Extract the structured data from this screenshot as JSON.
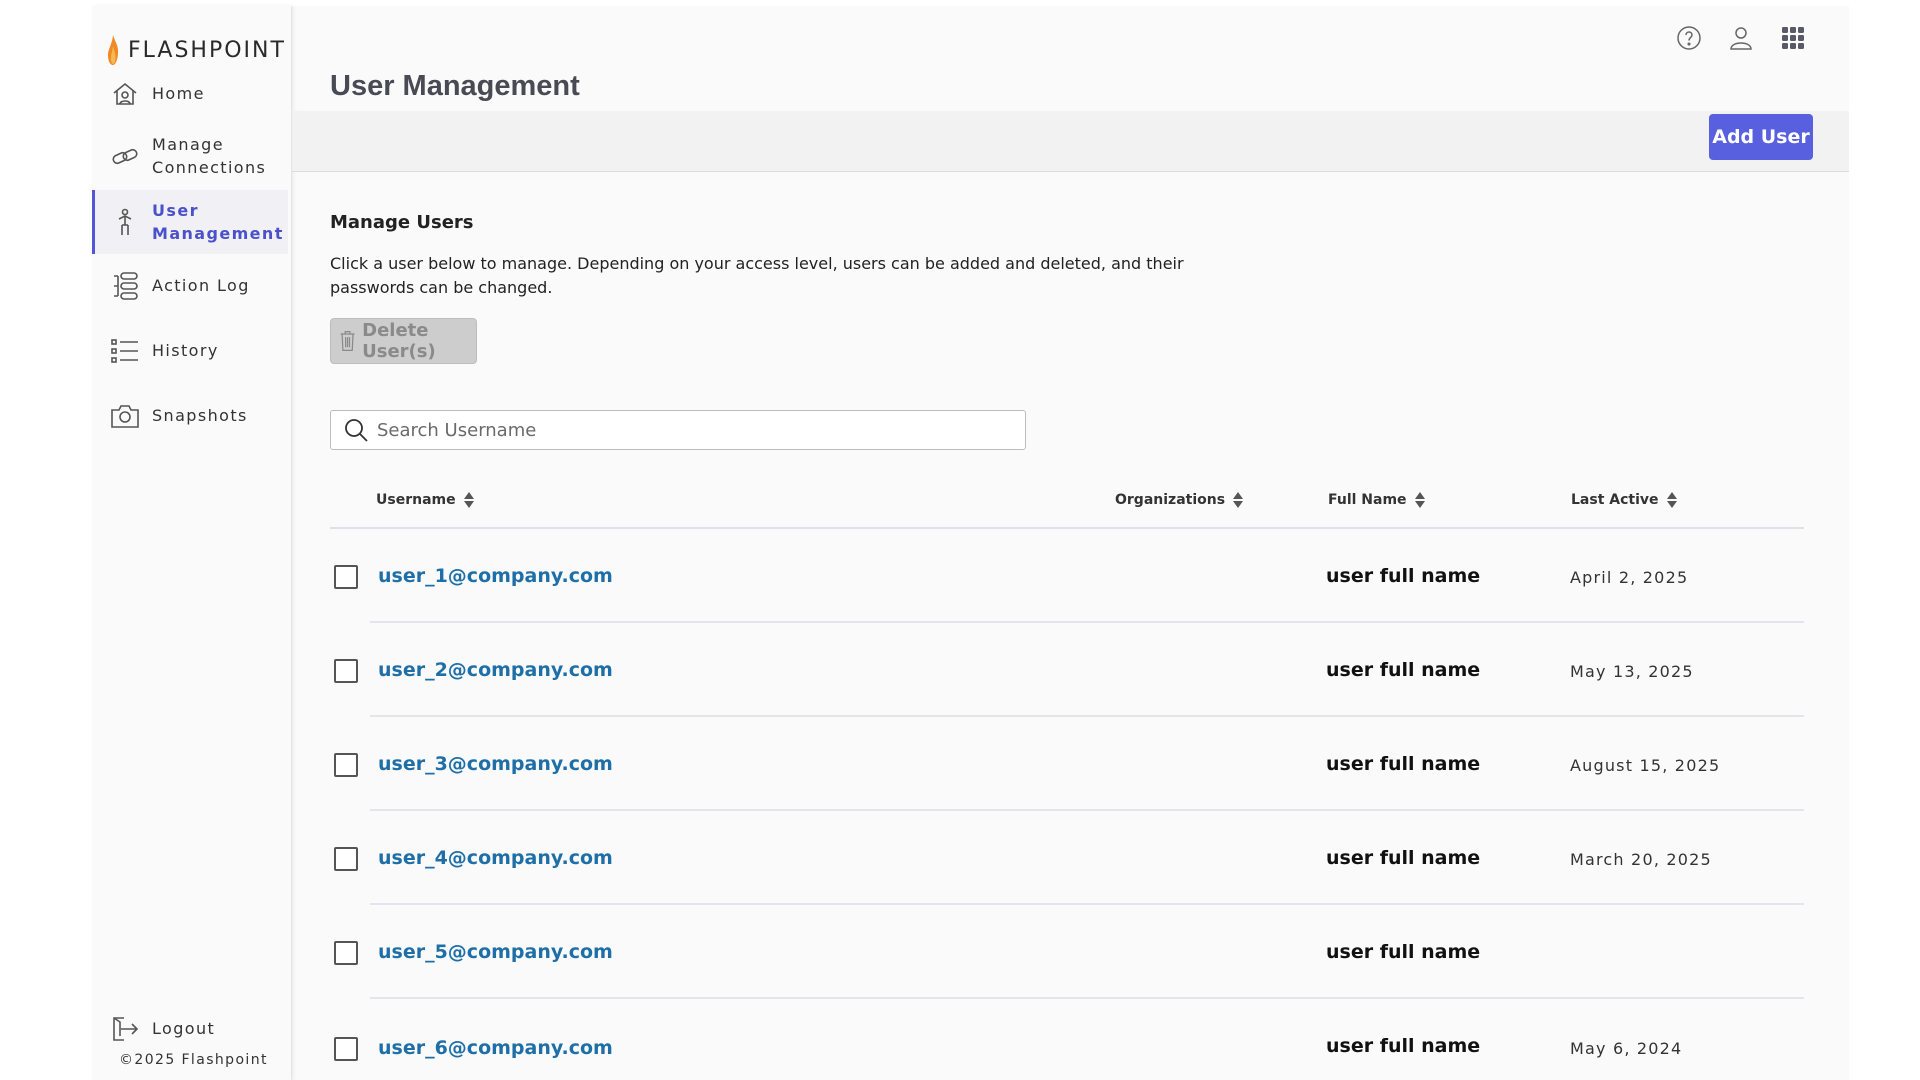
{
  "brand": {
    "name": "FLASHPOINT",
    "copyright": "©2025 Flashpoint",
    "accent": "#5860e0",
    "link_color": "#1e6fa8"
  },
  "sidebar": {
    "items": [
      {
        "label": "Home",
        "icon": "home-icon"
      },
      {
        "label": "Manage Connections",
        "icon": "link-icon"
      },
      {
        "label": "User Management",
        "icon": "person-icon",
        "active": true
      },
      {
        "label": "Action Log",
        "icon": "action-log-icon"
      },
      {
        "label": "History",
        "icon": "list-icon"
      },
      {
        "label": "Snapshots",
        "icon": "camera-icon"
      }
    ],
    "logout_label": "Logout"
  },
  "header": {
    "icons": [
      "help-icon",
      "user-icon",
      "apps-grid-icon"
    ]
  },
  "page": {
    "title": "User Management",
    "add_user_label": "Add User",
    "section_title": "Manage Users",
    "section_desc": "Click a user below to manage. Depending on your access level, users can be added and deleted, and their passwords can be changed.",
    "delete_label": "Delete User(s)",
    "search_placeholder": "Search Username",
    "search_value": ""
  },
  "table": {
    "columns": [
      "Username",
      "Organizations",
      "Full Name",
      "Last Active"
    ],
    "rows": [
      {
        "username": "user_1@company.com",
        "organizations": "",
        "full_name": "user full name",
        "last_active": "April 2, 2025"
      },
      {
        "username": "user_2@company.com",
        "organizations": "",
        "full_name": "user full name",
        "last_active": "May 13, 2025"
      },
      {
        "username": "user_3@company.com",
        "organizations": "",
        "full_name": "user full name",
        "last_active": "August 15, 2025"
      },
      {
        "username": "user_4@company.com",
        "organizations": "",
        "full_name": "user full name",
        "last_active": "March 20, 2025"
      },
      {
        "username": "user_5@company.com",
        "organizations": "",
        "full_name": "user full name",
        "last_active": ""
      },
      {
        "username": "user_6@company.com",
        "organizations": "",
        "full_name": "user full name",
        "last_active": "May 6, 2024"
      }
    ]
  }
}
